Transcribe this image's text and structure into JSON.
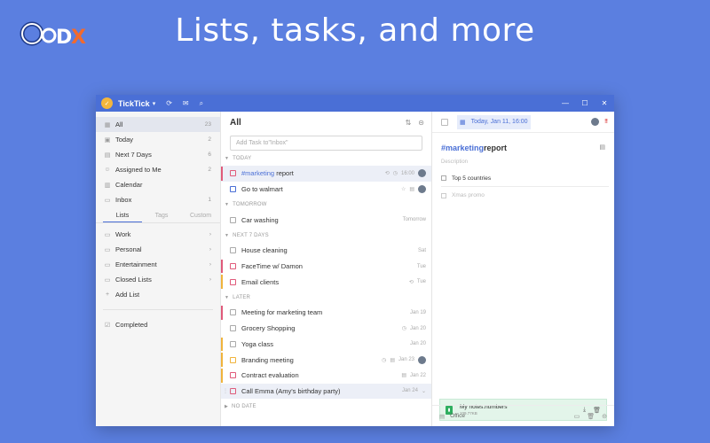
{
  "headline": "Lists, tasks, and more",
  "brand_logo_text": "CoDX",
  "app": {
    "name": "TickTick",
    "titlebar_icons": [
      "sync-icon",
      "inbox-icon",
      "search-icon"
    ],
    "window_controls": [
      "minimize-icon",
      "maximize-icon",
      "close-icon"
    ]
  },
  "sidebar": {
    "smart_lists": [
      {
        "label": "All",
        "count": "23",
        "icon": "all-icon"
      },
      {
        "label": "Today",
        "count": "2",
        "icon": "today-icon"
      },
      {
        "label": "Next 7 Days",
        "count": "6",
        "icon": "week-icon"
      },
      {
        "label": "Assigned to Me",
        "count": "2",
        "icon": "person-icon"
      },
      {
        "label": "Calendar",
        "count": "",
        "icon": "calendar-icon"
      },
      {
        "label": "Inbox",
        "count": "1",
        "icon": "inbox-icon"
      }
    ],
    "tabs": [
      "Lists",
      "Tags",
      "Custom"
    ],
    "folders": [
      "Work",
      "Personal",
      "Entertainment",
      "Closed Lists"
    ],
    "add_list": "Add List",
    "completed": "Completed"
  },
  "tasklist": {
    "title": "All",
    "add_placeholder": "Add Task to\"Inbox\"",
    "sections": {
      "today": "TODAY",
      "tomorrow": "TOMORROW",
      "next7": "NEXT 7 DAYS",
      "later": "LATER",
      "nodate": "NO DATE"
    },
    "tasks": {
      "t1": {
        "tag": "#marketing",
        "name": " report",
        "meta": "16:00"
      },
      "t2": {
        "name": "Go to walmart",
        "meta": ""
      },
      "t3": {
        "name": "Car washing",
        "meta": "Tomorrow"
      },
      "t4": {
        "name": "House cleaning",
        "meta": "Sat"
      },
      "t5": {
        "name": "FaceTime w/ Damon",
        "meta": "Tue"
      },
      "t6": {
        "name": "Email clients",
        "meta": "Tue"
      },
      "t7": {
        "name": "Meeting for marketing team",
        "meta": "Jan 19"
      },
      "t8": {
        "name": "Grocery Shopping",
        "meta": "Jan 20"
      },
      "t9": {
        "name": "Yoga class",
        "meta": "Jan 20"
      },
      "t10": {
        "name": "Branding meeting",
        "meta": "Jan 23"
      },
      "t11": {
        "name": "Contract evaluation",
        "meta": "Jan 22"
      },
      "t12": {
        "name": "Call Emma (Amy's birthday party)",
        "meta": "Jan 24"
      }
    }
  },
  "detail": {
    "date": "Today, Jan 11, 16:00",
    "title_tag": "#marketing",
    "title_rest": " report",
    "description_placeholder": "Description",
    "checklist": [
      "Top 5 countries"
    ],
    "checklist_add": "Xmas promo",
    "attachment": {
      "name": "My notes.numbers",
      "size": "109.77KB"
    },
    "footer_list": "Office"
  },
  "colors": {
    "background": "#5b7fe0",
    "accent": "#4a6fd6",
    "priority_high": "#e05a7a",
    "priority_med": "#f0b43c",
    "priority_low": "#4a6fd6"
  }
}
